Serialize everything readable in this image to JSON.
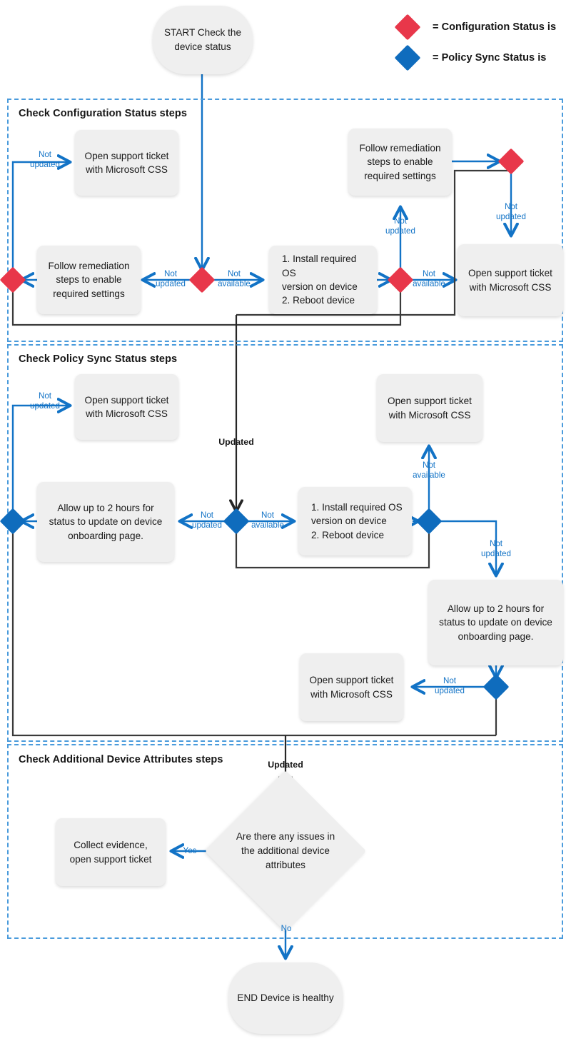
{
  "legend": {
    "items": [
      {
        "name": "config-status",
        "color": "#e8374a",
        "label": "= Configuration Status is"
      },
      {
        "name": "policy-sync-status",
        "color": "#0f6cbd",
        "label": "= Policy Sync Status is"
      }
    ]
  },
  "terminals": {
    "start": {
      "line1": "START",
      "line2": "Check the device",
      "line3": "status"
    },
    "end": {
      "line1": "END",
      "line2": "Device is healthy"
    }
  },
  "sections": [
    {
      "title": "Check Configuration Status steps"
    },
    {
      "title": "Check Policy Sync Status steps"
    },
    {
      "title": "Check Additional Device Attributes steps"
    }
  ],
  "boxes": {
    "cfg_ticket_left": {
      "l1": "Open support ticket",
      "l2": "with Microsoft CSS"
    },
    "cfg_remediation_left": {
      "l1": "Follow remediation",
      "l2": "steps to enable",
      "l3": "required settings"
    },
    "cfg_install": {
      "l1": "1. Install required OS",
      "l2": "    version on device",
      "l3": "2. Reboot device"
    },
    "cfg_remediation_right": {
      "l1": "Follow remediation",
      "l2": "steps to enable",
      "l3": "required settings"
    },
    "cfg_ticket_right": {
      "l1": "Open support ticket",
      "l2": "with Microsoft CSS"
    },
    "sync_ticket_left": {
      "l1": "Open support ticket",
      "l2": "with Microsoft CSS"
    },
    "sync_allow_left": {
      "l1": "Allow up to 2 hours for",
      "l2": "status to update on device",
      "l3": "onboarding page."
    },
    "sync_install": {
      "l1": "1. Install required OS",
      "l2": "    version on device",
      "l3": "2. Reboot device"
    },
    "sync_ticket_top": {
      "l1": "Open support ticket",
      "l2": "with Microsoft CSS"
    },
    "sync_allow_right": {
      "l1": "Allow up to 2 hours for",
      "l2": "status to update on device",
      "l3": "onboarding page."
    },
    "sync_ticket_bottom": {
      "l1": "Open support ticket",
      "l2": "with Microsoft CSS"
    },
    "attr_collect": {
      "l1": "Collect evidence,",
      "l2": "open support ticket"
    }
  },
  "decision": {
    "attributes": {
      "l1": "Are there any issues",
      "l2": "in the additional",
      "l3": "device attributes"
    }
  },
  "labels": {
    "cfg_top_left_not": "Not",
    "cfg_top_left_updated": "updated",
    "cfg_mid_not": "Not",
    "cfg_mid_updated": "updated",
    "cfg_mid_avail_not": "Not",
    "cfg_mid_avail": "available",
    "cfg_up_not": "Not",
    "cfg_up_updated": "updated",
    "cfg_right_avail_not": "Not",
    "cfg_right_avail": "available",
    "cfg_topright_not": "Not",
    "cfg_topright_updated": "updated",
    "updated_1": "Updated",
    "sync_top_left_not": "Not",
    "sync_top_left_updated": "updated",
    "sync_mid_not": "Not",
    "sync_mid_updated": "updated",
    "sync_avail_not": "Not",
    "sync_avail": "available",
    "sync_up_not": "Not",
    "sync_up_available": "available",
    "sync_right_not": "Not",
    "sync_right_updated": "updated",
    "sync_bottom_not": "Not",
    "sync_bottom_updated": "updated",
    "updated_2": "Updated",
    "yes": "Yes",
    "no": "No"
  },
  "colors": {
    "red": "#e8374a",
    "blue": "#0f6cbd",
    "arrow_blue": "#1273c6",
    "arrow_dark": "#3a3a3a",
    "section_border": "#4a9bdc",
    "box_fill": "#efefef"
  }
}
